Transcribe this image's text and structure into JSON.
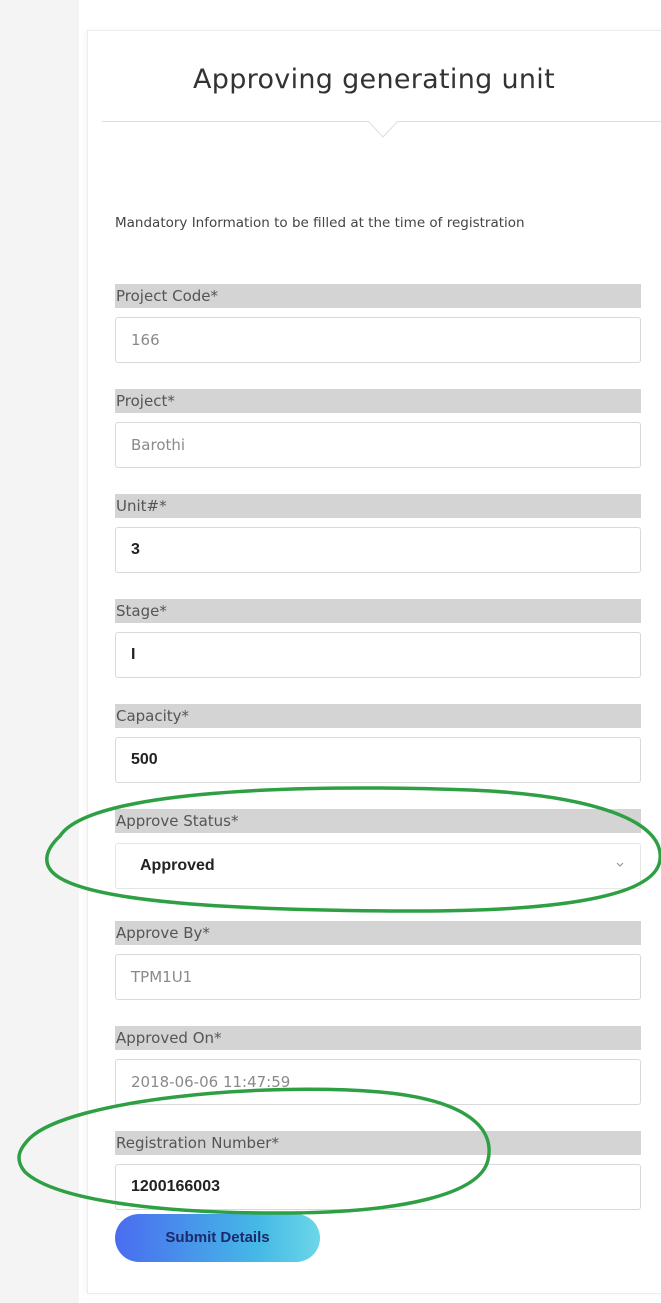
{
  "form": {
    "title": "Approving generating unit",
    "intro": "Mandatory Information to be filled at the time of registration",
    "fields": [
      {
        "label": "Project Code*",
        "value": "166"
      },
      {
        "label": "Project*",
        "value": "Barothi"
      },
      {
        "label": "Unit#*",
        "value": "3"
      },
      {
        "label": "Stage*",
        "value": "I"
      },
      {
        "label": "Capacity*",
        "value": "500"
      },
      {
        "label": "Approve Status*",
        "value": "Approved"
      },
      {
        "label": "Approve By*",
        "value": "TPM1U1"
      },
      {
        "label": "Approved On*",
        "value": "2018-06-06 11:47:59"
      },
      {
        "label": "Registration Number*",
        "value": "1200166003"
      }
    ],
    "submit_label": "Submit Details"
  },
  "colors": {
    "annotation_ellipse": "#2ea043",
    "button_gradient_start": "#4a6cf0",
    "button_gradient_end": "#6cd7e8",
    "label_background": "#d4d4d4"
  },
  "icons": {
    "select_arrow": "chevron-down-icon"
  }
}
